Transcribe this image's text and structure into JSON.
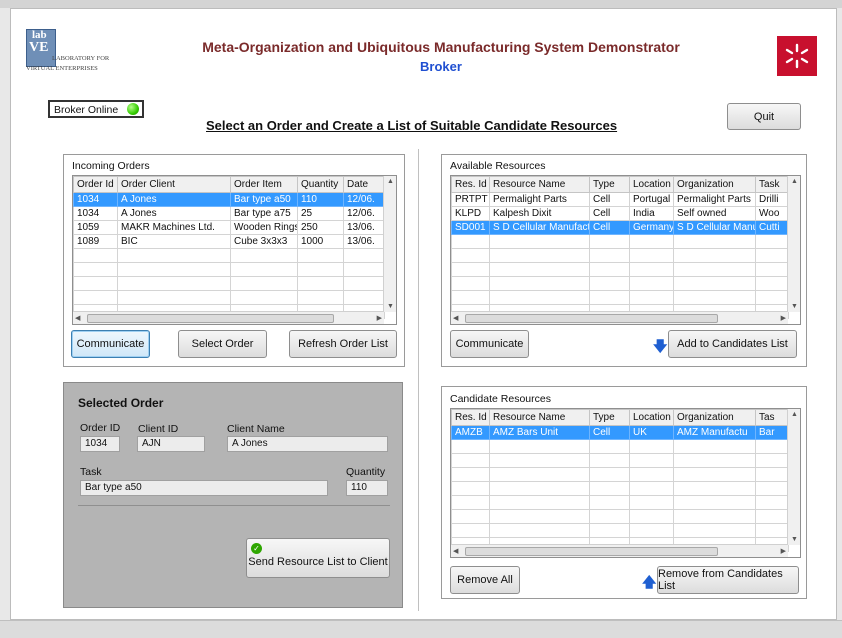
{
  "logo": {
    "top": "lab",
    "mid": "VE",
    "small": "LABORATORY FOR",
    "bottom": "VIRTUAL ENTERPRISES"
  },
  "header": {
    "title": "Meta-Organization and Ubiquitous Manufacturing System Demonstrator",
    "subtitle": "Broker"
  },
  "status": {
    "label": "Broker Online"
  },
  "instruction": "Select an Order and Create a List of Suitable Candidate Resources",
  "quit_label": "Quit",
  "orders": {
    "title": "Incoming Orders",
    "columns": [
      "Order Id",
      "Order Client",
      "Order Item",
      "Quantity",
      "Date"
    ],
    "rows": [
      [
        "1034",
        "A Jones",
        "Bar type a50",
        "110",
        "12/06."
      ],
      [
        "1034",
        "A Jones",
        "Bar type a75",
        "25",
        "12/06."
      ],
      [
        "1059",
        "MAKR Machines Ltd.",
        "Wooden Rings",
        "250",
        "13/06."
      ],
      [
        "1089",
        "BIC",
        "Cube 3x3x3",
        "1000",
        "13/06."
      ]
    ],
    "selected_row": 0,
    "buttons": {
      "communicate": "Communicate",
      "select": "Select Order",
      "refresh": "Refresh Order List"
    }
  },
  "resources": {
    "title": "Available Resources",
    "columns": [
      "Res. Id",
      "Resource Name",
      "Type",
      "Location",
      "Organization",
      "Task"
    ],
    "rows": [
      [
        "PRTPT",
        "Permalight Parts",
        "Cell",
        "Portugal",
        "Permalight Parts",
        "Drilli"
      ],
      [
        "KLPD",
        "Kalpesh Dixit",
        "Cell",
        "India",
        "Self owned",
        "Woo"
      ],
      [
        "SD001",
        "S D Cellular Manufact",
        "Cell",
        "Germany",
        "S D Cellular Manu",
        "Cutti"
      ]
    ],
    "selected_row": 2,
    "buttons": {
      "communicate": "Communicate",
      "add": "Add to Candidates List"
    }
  },
  "selected_order": {
    "title": "Selected Order",
    "order_id_label": "Order ID",
    "order_id": "1034",
    "client_id_label": "Client ID",
    "client_id": "AJN",
    "client_name_label": "Client Name",
    "client_name": "A Jones",
    "task_label": "Task",
    "task": "Bar type a50",
    "quantity_label": "Quantity",
    "quantity": "110",
    "send_label": "Send Resource List to Client"
  },
  "candidates": {
    "title": "Candidate Resources",
    "columns": [
      "Res. Id",
      "Resource Name",
      "Type",
      "Location",
      "Organization",
      "Tas"
    ],
    "rows": [
      [
        "AMZB",
        "AMZ Bars Unit",
        "Cell",
        "UK",
        "AMZ Manufactu",
        "Bar"
      ]
    ],
    "selected_row": 0,
    "buttons": {
      "remove_all": "Remove All",
      "remove": "Remove from Candidates List"
    }
  },
  "colors": {
    "title": "#7a2a2a",
    "broker": "#1f4fd1",
    "selection": "#3399ff",
    "online": "#33cc00",
    "uminho": "#c8102e"
  }
}
